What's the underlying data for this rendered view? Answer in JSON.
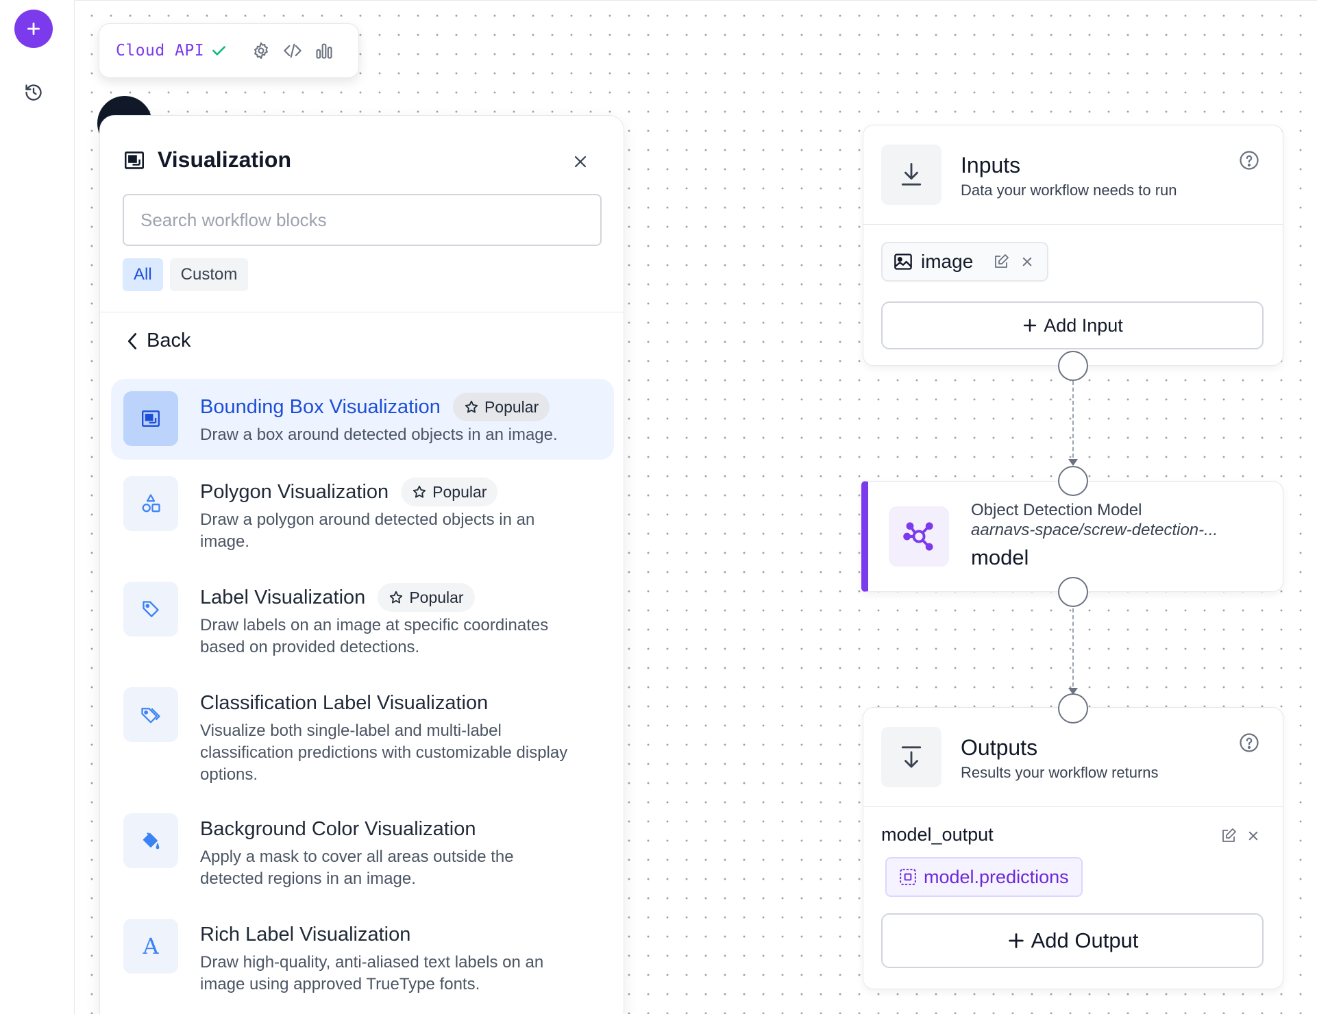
{
  "toolbar": {
    "environment_label": "Cloud API",
    "icons": [
      "check-icon",
      "gear-icon",
      "code-icon",
      "bar-chart-icon"
    ]
  },
  "left_rail": {
    "icons": [
      "plus-icon",
      "history-icon"
    ]
  },
  "panel": {
    "title": "Visualization",
    "search_placeholder": "Search workflow blocks",
    "filters": [
      "All",
      "Custom"
    ],
    "active_filter": "All",
    "back_label": "Back",
    "popular_label": "Popular",
    "blocks": [
      {
        "title": "Bounding Box Visualization",
        "description": "Draw a box around detected objects in an image.",
        "popular": true,
        "selected": true,
        "icon": "bounding-box-icon"
      },
      {
        "title": "Polygon Visualization",
        "description": "Draw a polygon around detected objects in an image.",
        "popular": true,
        "selected": false,
        "icon": "shapes-icon"
      },
      {
        "title": "Label Visualization",
        "description": "Draw labels on an image at specific coordinates based on provided detections.",
        "popular": true,
        "selected": false,
        "icon": "tag-icon"
      },
      {
        "title": "Classification Label Visualization",
        "description": "Visualize both single-label and multi-label classification predictions with customizable display options.",
        "popular": false,
        "selected": false,
        "icon": "tags-icon"
      },
      {
        "title": "Background Color Visualization",
        "description": "Apply a mask to cover all areas outside the detected regions in an image.",
        "popular": false,
        "selected": false,
        "icon": "paint-bucket-icon"
      },
      {
        "title": "Rich Label Visualization",
        "description": "Draw high-quality, anti-aliased text labels on an image using approved TrueType fonts.",
        "popular": false,
        "selected": false,
        "icon": "serif-a-icon"
      }
    ]
  },
  "inputs_node": {
    "title": "Inputs",
    "subtitle": "Data your workflow needs to run",
    "input_name": "image",
    "add_label": "Add Input"
  },
  "model_node": {
    "type_label": "Object Detection Model",
    "model_id": "aarnavs-space/screw-detection-...",
    "name": "model"
  },
  "outputs_node": {
    "title": "Outputs",
    "subtitle": "Results your workflow returns",
    "output_name": "model_output",
    "output_ref": "model.predictions",
    "add_label": "Add Output"
  },
  "colors": {
    "accent_purple": "#7c3aed",
    "selected_blue": "#1d4ed8",
    "icon_blue": "#3b82f6"
  }
}
